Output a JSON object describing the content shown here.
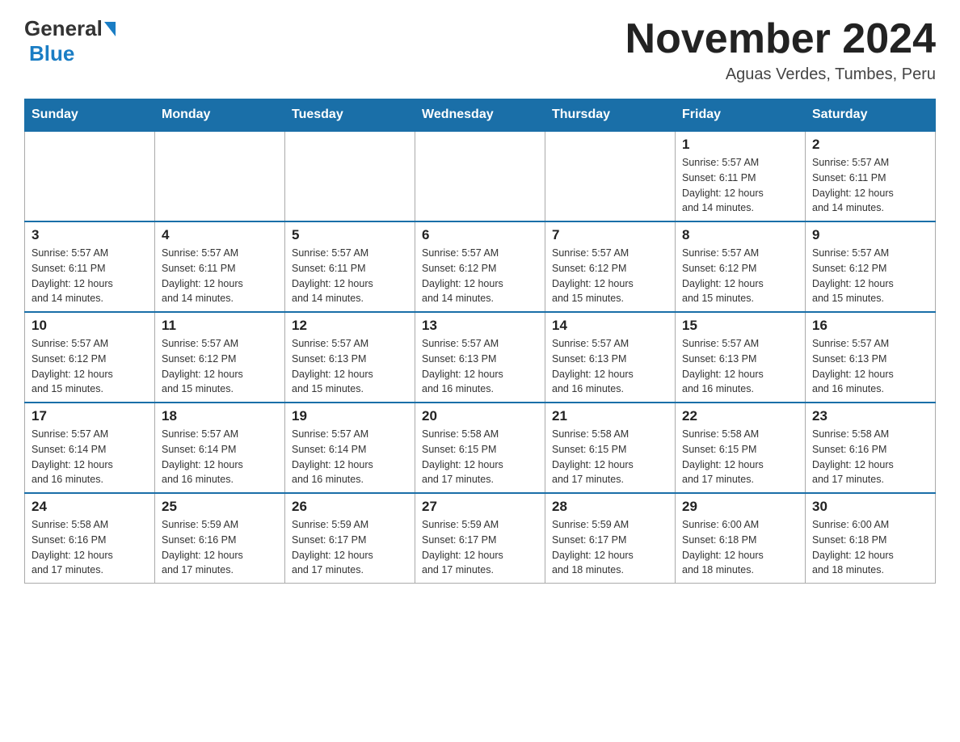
{
  "header": {
    "logo": {
      "general": "General",
      "blue": "Blue"
    },
    "title": "November 2024",
    "subtitle": "Aguas Verdes, Tumbes, Peru"
  },
  "weekdays": [
    "Sunday",
    "Monday",
    "Tuesday",
    "Wednesday",
    "Thursday",
    "Friday",
    "Saturday"
  ],
  "weeks": [
    [
      {
        "day": "",
        "info": ""
      },
      {
        "day": "",
        "info": ""
      },
      {
        "day": "",
        "info": ""
      },
      {
        "day": "",
        "info": ""
      },
      {
        "day": "",
        "info": ""
      },
      {
        "day": "1",
        "info": "Sunrise: 5:57 AM\nSunset: 6:11 PM\nDaylight: 12 hours\nand 14 minutes."
      },
      {
        "day": "2",
        "info": "Sunrise: 5:57 AM\nSunset: 6:11 PM\nDaylight: 12 hours\nand 14 minutes."
      }
    ],
    [
      {
        "day": "3",
        "info": "Sunrise: 5:57 AM\nSunset: 6:11 PM\nDaylight: 12 hours\nand 14 minutes."
      },
      {
        "day": "4",
        "info": "Sunrise: 5:57 AM\nSunset: 6:11 PM\nDaylight: 12 hours\nand 14 minutes."
      },
      {
        "day": "5",
        "info": "Sunrise: 5:57 AM\nSunset: 6:11 PM\nDaylight: 12 hours\nand 14 minutes."
      },
      {
        "day": "6",
        "info": "Sunrise: 5:57 AM\nSunset: 6:12 PM\nDaylight: 12 hours\nand 14 minutes."
      },
      {
        "day": "7",
        "info": "Sunrise: 5:57 AM\nSunset: 6:12 PM\nDaylight: 12 hours\nand 15 minutes."
      },
      {
        "day": "8",
        "info": "Sunrise: 5:57 AM\nSunset: 6:12 PM\nDaylight: 12 hours\nand 15 minutes."
      },
      {
        "day": "9",
        "info": "Sunrise: 5:57 AM\nSunset: 6:12 PM\nDaylight: 12 hours\nand 15 minutes."
      }
    ],
    [
      {
        "day": "10",
        "info": "Sunrise: 5:57 AM\nSunset: 6:12 PM\nDaylight: 12 hours\nand 15 minutes."
      },
      {
        "day": "11",
        "info": "Sunrise: 5:57 AM\nSunset: 6:12 PM\nDaylight: 12 hours\nand 15 minutes."
      },
      {
        "day": "12",
        "info": "Sunrise: 5:57 AM\nSunset: 6:13 PM\nDaylight: 12 hours\nand 15 minutes."
      },
      {
        "day": "13",
        "info": "Sunrise: 5:57 AM\nSunset: 6:13 PM\nDaylight: 12 hours\nand 16 minutes."
      },
      {
        "day": "14",
        "info": "Sunrise: 5:57 AM\nSunset: 6:13 PM\nDaylight: 12 hours\nand 16 minutes."
      },
      {
        "day": "15",
        "info": "Sunrise: 5:57 AM\nSunset: 6:13 PM\nDaylight: 12 hours\nand 16 minutes."
      },
      {
        "day": "16",
        "info": "Sunrise: 5:57 AM\nSunset: 6:13 PM\nDaylight: 12 hours\nand 16 minutes."
      }
    ],
    [
      {
        "day": "17",
        "info": "Sunrise: 5:57 AM\nSunset: 6:14 PM\nDaylight: 12 hours\nand 16 minutes."
      },
      {
        "day": "18",
        "info": "Sunrise: 5:57 AM\nSunset: 6:14 PM\nDaylight: 12 hours\nand 16 minutes."
      },
      {
        "day": "19",
        "info": "Sunrise: 5:57 AM\nSunset: 6:14 PM\nDaylight: 12 hours\nand 16 minutes."
      },
      {
        "day": "20",
        "info": "Sunrise: 5:58 AM\nSunset: 6:15 PM\nDaylight: 12 hours\nand 17 minutes."
      },
      {
        "day": "21",
        "info": "Sunrise: 5:58 AM\nSunset: 6:15 PM\nDaylight: 12 hours\nand 17 minutes."
      },
      {
        "day": "22",
        "info": "Sunrise: 5:58 AM\nSunset: 6:15 PM\nDaylight: 12 hours\nand 17 minutes."
      },
      {
        "day": "23",
        "info": "Sunrise: 5:58 AM\nSunset: 6:16 PM\nDaylight: 12 hours\nand 17 minutes."
      }
    ],
    [
      {
        "day": "24",
        "info": "Sunrise: 5:58 AM\nSunset: 6:16 PM\nDaylight: 12 hours\nand 17 minutes."
      },
      {
        "day": "25",
        "info": "Sunrise: 5:59 AM\nSunset: 6:16 PM\nDaylight: 12 hours\nand 17 minutes."
      },
      {
        "day": "26",
        "info": "Sunrise: 5:59 AM\nSunset: 6:17 PM\nDaylight: 12 hours\nand 17 minutes."
      },
      {
        "day": "27",
        "info": "Sunrise: 5:59 AM\nSunset: 6:17 PM\nDaylight: 12 hours\nand 17 minutes."
      },
      {
        "day": "28",
        "info": "Sunrise: 5:59 AM\nSunset: 6:17 PM\nDaylight: 12 hours\nand 18 minutes."
      },
      {
        "day": "29",
        "info": "Sunrise: 6:00 AM\nSunset: 6:18 PM\nDaylight: 12 hours\nand 18 minutes."
      },
      {
        "day": "30",
        "info": "Sunrise: 6:00 AM\nSunset: 6:18 PM\nDaylight: 12 hours\nand 18 minutes."
      }
    ]
  ]
}
